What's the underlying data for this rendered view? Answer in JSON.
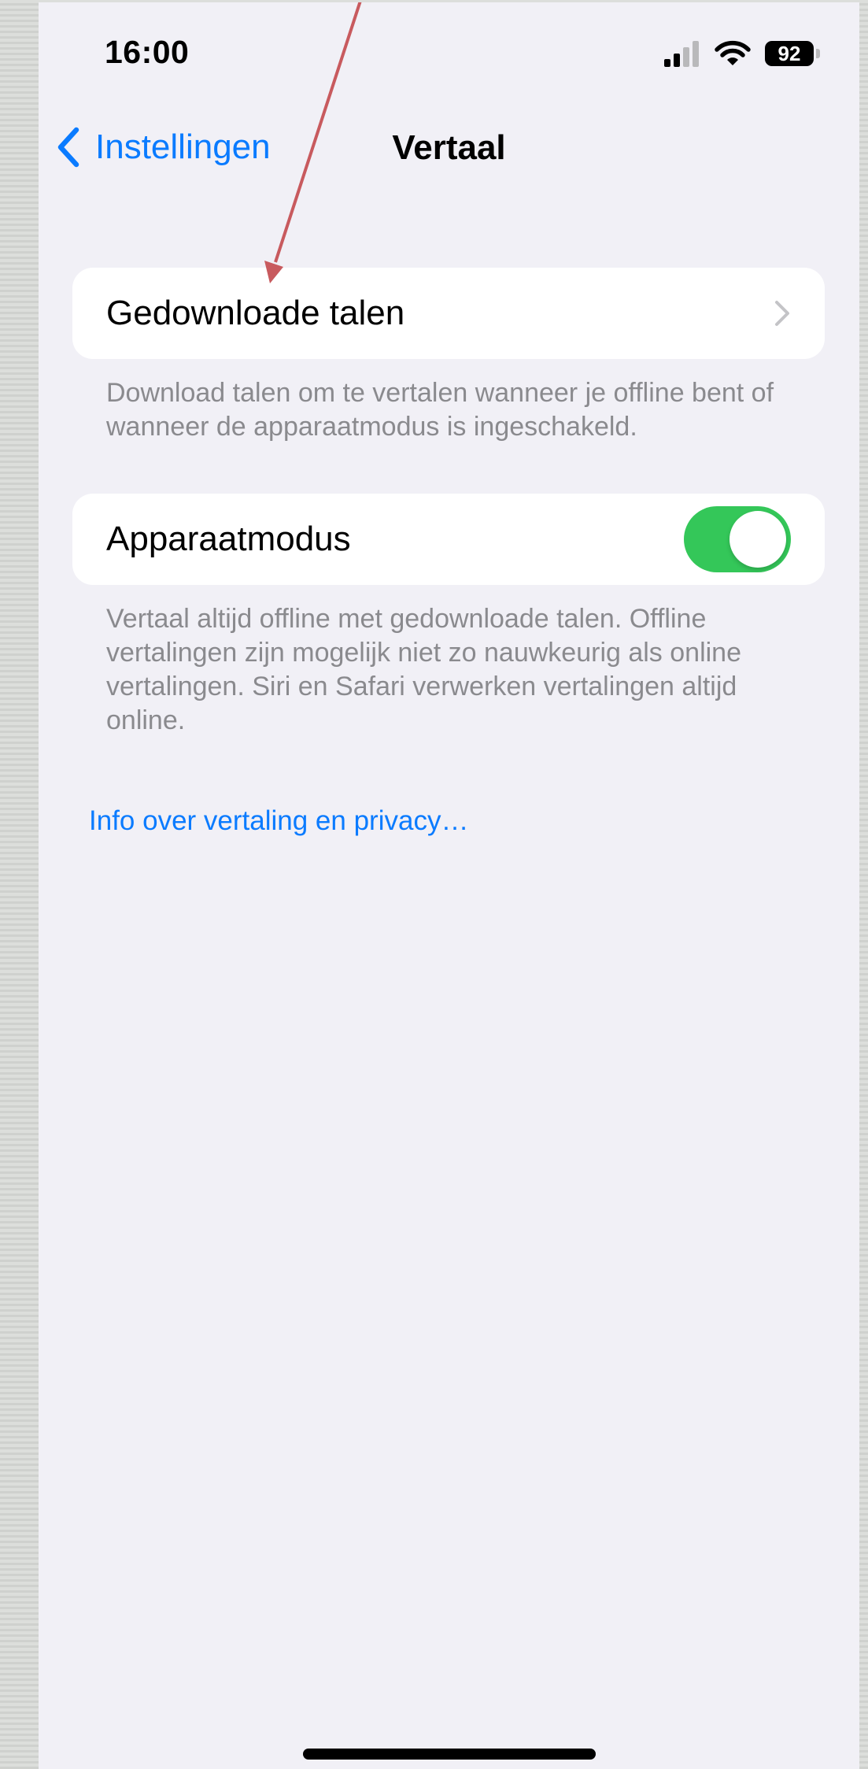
{
  "status_bar": {
    "time": "16:00",
    "battery_level": "92",
    "icons": [
      "signal-icon",
      "wifi-icon",
      "battery-icon"
    ]
  },
  "nav": {
    "back_label": "Instellingen",
    "title": "Vertaal"
  },
  "downloaded_languages": {
    "label": "Gedownloade talen",
    "footer": "Download talen om te vertalen wanneer je offline bent of wanneer de apparaatmodus is ingeschakeld."
  },
  "device_mode": {
    "label": "Apparaatmodus",
    "enabled": true,
    "footer": "Vertaal altijd offline met gedownloade talen. Offline vertalingen zijn mogelijk niet zo nauwkeurig als online vertalingen. Siri en Safari verwerken vertalingen altijd online."
  },
  "privacy_link": "Info over vertaling en privacy…",
  "colors": {
    "accent": "#0a7bff",
    "toggle_on": "#34c759",
    "background": "#f1f0f6",
    "annotation_arrow": "#c85a5e"
  }
}
